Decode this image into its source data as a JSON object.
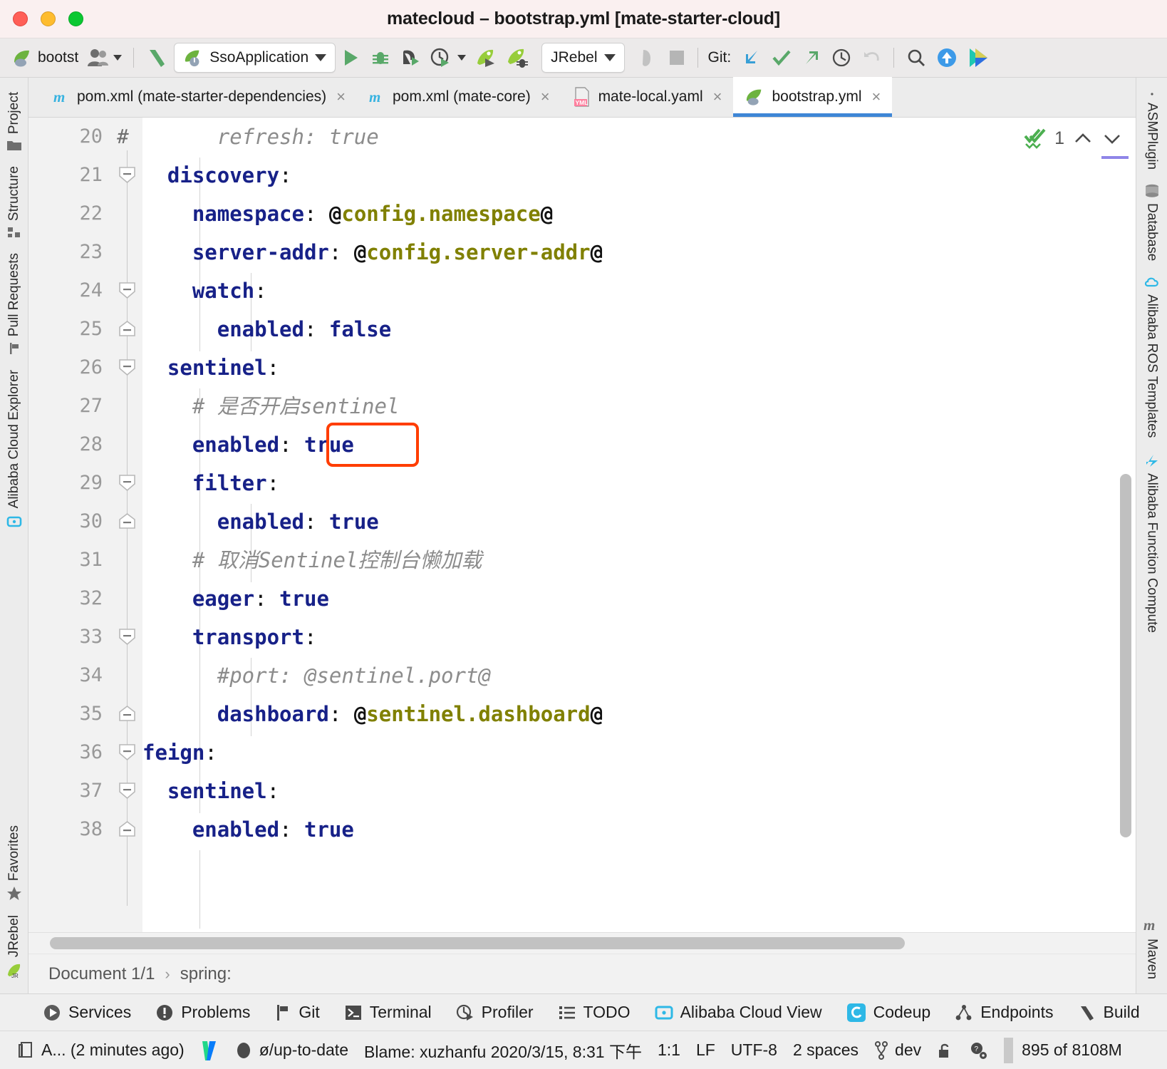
{
  "window": {
    "title": "matecloud – bootstrap.yml [mate-starter-cloud]",
    "traffic": {
      "close": "close-button",
      "minimize": "minimize-button",
      "zoom": "zoom-button"
    }
  },
  "toolbar": {
    "project_label": "bootst",
    "run_config": "SsoApplication",
    "jrebel_label": "JRebel",
    "git_label": "Git:",
    "icons": [
      "spring-leaf-icon",
      "user-avatar-icon",
      "navigate-back-icon",
      "build-hammer-icon",
      "run-icon",
      "debug-icon",
      "run-coverage-icon",
      "profile-run-icon",
      "jrebel-run-icon",
      "jrebel-debug-icon",
      "attach-icon",
      "stop-icon",
      "git-update-icon",
      "git-commit-icon",
      "git-push-icon",
      "git-history-icon",
      "git-rollback-icon",
      "search-everywhere-icon",
      "upload-icon",
      "idea-services-icon"
    ]
  },
  "tabs": [
    {
      "label": "pom.xml (mate-starter-dependencies)",
      "icon": "maven-m-icon",
      "active": false,
      "close": "×"
    },
    {
      "label": "pom.xml (mate-core)",
      "icon": "maven-m-icon",
      "active": false,
      "close": "×"
    },
    {
      "label": "mate-local.yaml",
      "icon": "yml-file-icon",
      "active": false,
      "close": "×"
    },
    {
      "label": "bootstrap.yml",
      "icon": "spring-yaml-icon",
      "active": true,
      "close": "×"
    }
  ],
  "left_tools": [
    {
      "label": "Project",
      "icon": "project-folder-icon"
    },
    {
      "label": "Structure",
      "icon": "structure-icon"
    },
    {
      "label": "Pull Requests",
      "icon": "pull-request-icon"
    },
    {
      "label": "Alibaba Cloud Explorer",
      "icon": "alibaba-cloud-icon"
    },
    {
      "label": "Favorites",
      "icon": "star-icon"
    },
    {
      "label": "JRebel",
      "icon": "jrebel-rocket-icon"
    }
  ],
  "right_tools": [
    {
      "label": "ASMPlugin",
      "icon": "asm-plugin-icon"
    },
    {
      "label": "Database",
      "icon": "database-icon"
    },
    {
      "label": "Alibaba ROS Templates",
      "icon": "ros-cloud-icon"
    },
    {
      "label": "Alibaba Function Compute",
      "icon": "function-compute-icon"
    },
    {
      "label": "Maven",
      "icon": "maven-m-icon"
    }
  ],
  "editor": {
    "first_line_number": 20,
    "inspection_count": "1",
    "inspection_icon": "inspection-ok-icon",
    "prev_icon": "chevron-up-icon",
    "next_icon": "chevron-down-icon",
    "highlight": {
      "line": 28,
      "text": "true",
      "color": "#ff3d00"
    },
    "lines": [
      {
        "n": 20,
        "fold": "none",
        "indent": 0,
        "gutter_hash": "#",
        "tokens": [
          {
            "t": "comment",
            "v": "      refresh: true"
          }
        ]
      },
      {
        "n": 21,
        "fold": "start",
        "indent": 1,
        "tokens": [
          {
            "t": "key",
            "v": "  discovery"
          },
          {
            "t": "colon",
            "v": ":"
          }
        ]
      },
      {
        "n": 22,
        "fold": "none",
        "indent": 2,
        "tokens": [
          {
            "t": "key",
            "v": "    namespace"
          },
          {
            "t": "colon",
            "v": ": "
          },
          {
            "t": "at",
            "v": "@"
          },
          {
            "t": "ph",
            "v": "config.namespace"
          },
          {
            "t": "at",
            "v": "@"
          }
        ]
      },
      {
        "n": 23,
        "fold": "none",
        "indent": 2,
        "tokens": [
          {
            "t": "key",
            "v": "    server-addr"
          },
          {
            "t": "colon",
            "v": ": "
          },
          {
            "t": "at",
            "v": "@"
          },
          {
            "t": "ph",
            "v": "config.server-addr"
          },
          {
            "t": "at",
            "v": "@"
          }
        ]
      },
      {
        "n": 24,
        "fold": "start",
        "indent": 2,
        "tokens": [
          {
            "t": "key",
            "v": "    watch"
          },
          {
            "t": "colon",
            "v": ":"
          }
        ]
      },
      {
        "n": 25,
        "fold": "end",
        "indent": 3,
        "tokens": [
          {
            "t": "key",
            "v": "      enabled"
          },
          {
            "t": "colon",
            "v": ": "
          },
          {
            "t": "val",
            "v": "false"
          }
        ]
      },
      {
        "n": 26,
        "fold": "start",
        "indent": 0,
        "tokens": [
          {
            "t": "key",
            "v": "  sentinel"
          },
          {
            "t": "colon",
            "v": ":"
          }
        ]
      },
      {
        "n": 27,
        "fold": "none",
        "indent": 1,
        "tokens": [
          {
            "t": "comment",
            "v": "    # 是否开启sentinel"
          }
        ]
      },
      {
        "n": 28,
        "fold": "none",
        "indent": 1,
        "tokens": [
          {
            "t": "key",
            "v": "    enabled"
          },
          {
            "t": "colon",
            "v": ": "
          },
          {
            "t": "val",
            "v": "true"
          }
        ]
      },
      {
        "n": 29,
        "fold": "start",
        "indent": 1,
        "tokens": [
          {
            "t": "key",
            "v": "    filter"
          },
          {
            "t": "colon",
            "v": ":"
          }
        ]
      },
      {
        "n": 30,
        "fold": "end",
        "indent": 2,
        "tokens": [
          {
            "t": "key",
            "v": "      enabled"
          },
          {
            "t": "colon",
            "v": ": "
          },
          {
            "t": "val",
            "v": "true"
          }
        ]
      },
      {
        "n": 31,
        "fold": "none",
        "indent": 1,
        "tokens": [
          {
            "t": "comment",
            "v": "    # 取消Sentinel控制台懒加载"
          }
        ]
      },
      {
        "n": 32,
        "fold": "none",
        "indent": 1,
        "tokens": [
          {
            "t": "key",
            "v": "    eager"
          },
          {
            "t": "colon",
            "v": ": "
          },
          {
            "t": "val",
            "v": "true"
          }
        ]
      },
      {
        "n": 33,
        "fold": "start",
        "indent": 1,
        "tokens": [
          {
            "t": "key",
            "v": "    transport"
          },
          {
            "t": "colon",
            "v": ":"
          }
        ]
      },
      {
        "n": 34,
        "fold": "none",
        "indent": 2,
        "tokens": [
          {
            "t": "comment",
            "v": "      #port: @sentinel.port@"
          }
        ]
      },
      {
        "n": 35,
        "fold": "end",
        "indent": 2,
        "tokens": [
          {
            "t": "key",
            "v": "      dashboard"
          },
          {
            "t": "colon",
            "v": ": "
          },
          {
            "t": "at",
            "v": "@"
          },
          {
            "t": "ph",
            "v": "sentinel.dashboard"
          },
          {
            "t": "at",
            "v": "@"
          }
        ]
      },
      {
        "n": 36,
        "fold": "start",
        "indent": 0,
        "tokens": [
          {
            "t": "key",
            "v": "feign"
          },
          {
            "t": "colon",
            "v": ":"
          }
        ]
      },
      {
        "n": 37,
        "fold": "start",
        "indent": 0,
        "tokens": [
          {
            "t": "key",
            "v": "  sentinel"
          },
          {
            "t": "colon",
            "v": ":"
          }
        ]
      },
      {
        "n": 38,
        "fold": "end",
        "indent": 1,
        "tokens": [
          {
            "t": "key",
            "v": "    enabled"
          },
          {
            "t": "colon",
            "v": ": "
          },
          {
            "t": "val",
            "v": "true"
          }
        ]
      }
    ]
  },
  "breadcrumb": {
    "document": "Document 1/1",
    "separator": "›",
    "node": "spring:"
  },
  "toolwindow_bar": [
    {
      "label": "Services",
      "icon": "services-play-icon"
    },
    {
      "label": "Problems",
      "icon": "problems-warning-icon"
    },
    {
      "label": "Git",
      "icon": "git-branch-icon"
    },
    {
      "label": "Terminal",
      "icon": "terminal-icon"
    },
    {
      "label": "Profiler",
      "icon": "profiler-icon"
    },
    {
      "label": "TODO",
      "icon": "todo-list-icon"
    },
    {
      "label": "Alibaba Cloud View",
      "icon": "alibaba-cloud-view-icon"
    },
    {
      "label": "Codeup",
      "icon": "codeup-icon"
    },
    {
      "label": "Endpoints",
      "icon": "endpoints-icon"
    },
    {
      "label": "Build",
      "icon": "build-hammer-icon"
    }
  ],
  "statusbar": {
    "event_log": "A... (2 minutes ago)",
    "event_log_icon": "event-log-icon",
    "vcs_icon": "intellij-v-icon",
    "sync_status": "ø/up-to-date",
    "sync_icon": "sync-circle-icon",
    "blame": "Blame: xuzhanfu 2020/3/15, 8:31 下午",
    "caret_position": "1:1",
    "line_separator": "LF",
    "encoding": "UTF-8",
    "indent": "2 spaces",
    "branch": "dev",
    "branch_icon": "git-branch-icon",
    "lock_icon": "unlocked-icon",
    "inspection_icon": "inspection-settings-icon",
    "memory": "895 of 8108M"
  },
  "colors": {
    "accent": "#3e86d6",
    "highlight": "#ff3d00",
    "key": "#172188",
    "placeholder": "#808000",
    "comment": "#8c8c8c",
    "title_bg": "#faf0f0"
  }
}
